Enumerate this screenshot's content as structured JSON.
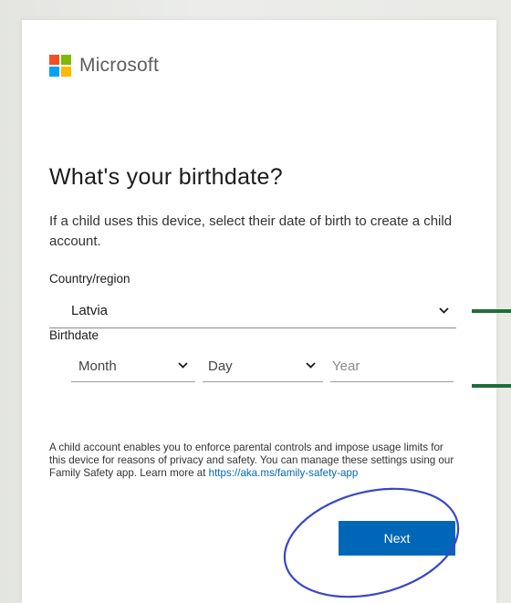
{
  "logo": {
    "text": "Microsoft",
    "colors": [
      "#f25022",
      "#7fba00",
      "#00a4ef",
      "#ffb900"
    ]
  },
  "title": "What's your birthdate?",
  "description": "If a child uses this device, select their date of birth to create a child account.",
  "country": {
    "label": "Country/region",
    "value": "Latvia"
  },
  "birthdate": {
    "label": "Birthdate",
    "month_placeholder": "Month",
    "day_placeholder": "Day",
    "year_placeholder": "Year"
  },
  "info": {
    "text": "A child account enables you to enforce parental controls and impose usage limits for this device for reasons of privacy and safety. You can manage these settings using our Family Safety app. Learn more at ",
    "link": "https://aka.ms/family-safety-app"
  },
  "next_button": "Next",
  "annotations": {
    "marker_color": "#1f6e3a",
    "circle_color": "#3a46c8"
  }
}
